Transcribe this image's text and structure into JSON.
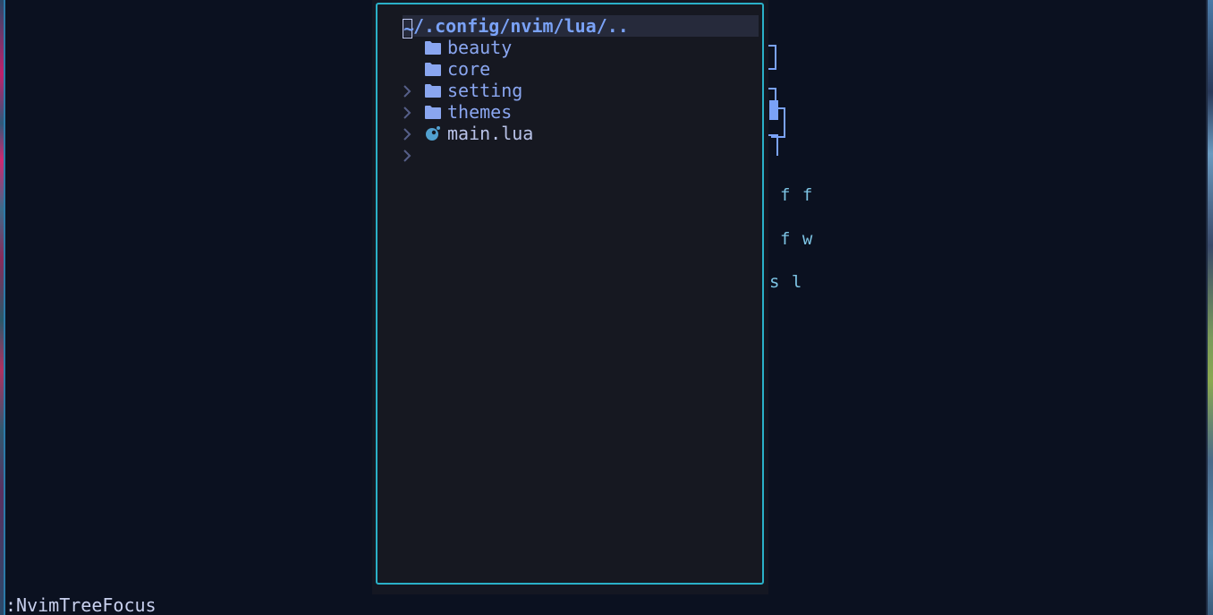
{
  "window": {
    "app": "nvim"
  },
  "background_text": {
    "line1": "f f",
    "line2": "f w",
    "line3": "s l"
  },
  "tree": {
    "root_cursor_char": "~",
    "root_path": "/.config/nvim/lua/..",
    "items": [
      {
        "label": "beauty",
        "type": "folder",
        "icon": "folder-icon"
      },
      {
        "label": "core",
        "type": "folder",
        "icon": "folder-icon"
      },
      {
        "label": "setting",
        "type": "folder",
        "icon": "folder-icon"
      },
      {
        "label": "themes",
        "type": "folder",
        "icon": "folder-icon"
      },
      {
        "label": "main.lua",
        "type": "file",
        "icon": "lua-icon"
      }
    ]
  },
  "cmdline": {
    "text": ":NvimTreeFocus"
  },
  "colors": {
    "background": "#0b1120",
    "float_bg": "#161821",
    "float_border": "#2ab0c8",
    "folder": "#8aa6f0",
    "lua": "#51a0cf",
    "root_highlight": "#262a3b"
  }
}
